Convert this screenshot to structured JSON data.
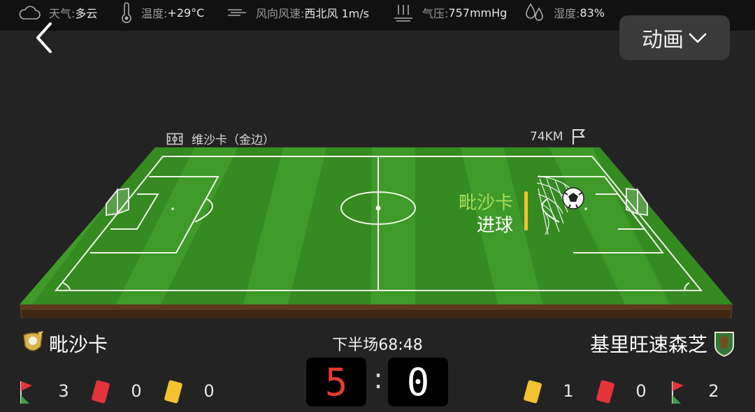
{
  "weather": {
    "sky_label": "天气:",
    "sky_value": "多云",
    "temp_label": "温度:",
    "temp_value": "+29°C",
    "wind_label": "风向风速:",
    "wind_value": "西北风 1m/s",
    "pressure_label": "气压:",
    "pressure_value": "757mmHg",
    "humidity_label": "湿度:",
    "humidity_value": "83%"
  },
  "header": {
    "animation_label": "动画"
  },
  "pitch": {
    "venue": "维沙卡（金边）",
    "distance": "74KM",
    "event_team": "毗沙卡",
    "event_text": "进球"
  },
  "match": {
    "home_team": "毗沙卡",
    "away_team": "基里旺速森芝",
    "period_time": "下半场68:48",
    "home_score": "5",
    "away_score": "0",
    "separator": ":"
  },
  "stats": {
    "home": {
      "corners": "3",
      "red_cards": "0",
      "yellow_cards": "0"
    },
    "away": {
      "yellow_cards": "1",
      "red_cards": "0",
      "corners": "2"
    }
  },
  "colors": {
    "pitch_green": "#3f9a2a",
    "event_team": "#a5e05a",
    "event_bar": "#f2c230",
    "home_score": "#e53a32"
  }
}
